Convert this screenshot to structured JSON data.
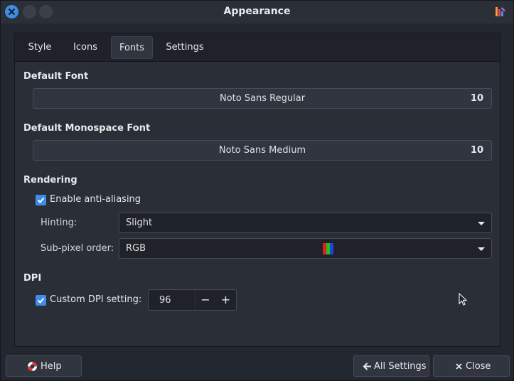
{
  "window": {
    "title": "Appearance"
  },
  "tabs": [
    {
      "label": "Style",
      "active": false
    },
    {
      "label": "Icons",
      "active": false
    },
    {
      "label": "Fonts",
      "active": true
    },
    {
      "label": "Settings",
      "active": false
    }
  ],
  "fonts": {
    "default_title": "Default Font",
    "default_font_name": "Noto Sans Regular",
    "default_font_size": "10",
    "mono_title": "Default Monospace Font",
    "mono_font_name": "Noto Sans Medium",
    "mono_font_size": "10"
  },
  "rendering": {
    "title": "Rendering",
    "antialias_label": "Enable anti-aliasing",
    "antialias_checked": true,
    "hinting_label": "Hinting:",
    "hinting_value": "Slight",
    "subpixel_label": "Sub-pixel order:",
    "subpixel_value": "RGB"
  },
  "dpi": {
    "title": "DPI",
    "custom_label": "Custom DPI setting:",
    "custom_checked": true,
    "value": "96"
  },
  "footer": {
    "help_label": "Help",
    "all_settings_label": "All Settings",
    "close_label": "Close"
  },
  "colors": {
    "accent": "#3d8ee6",
    "background": "#232730",
    "panel": "#2a2e37"
  }
}
